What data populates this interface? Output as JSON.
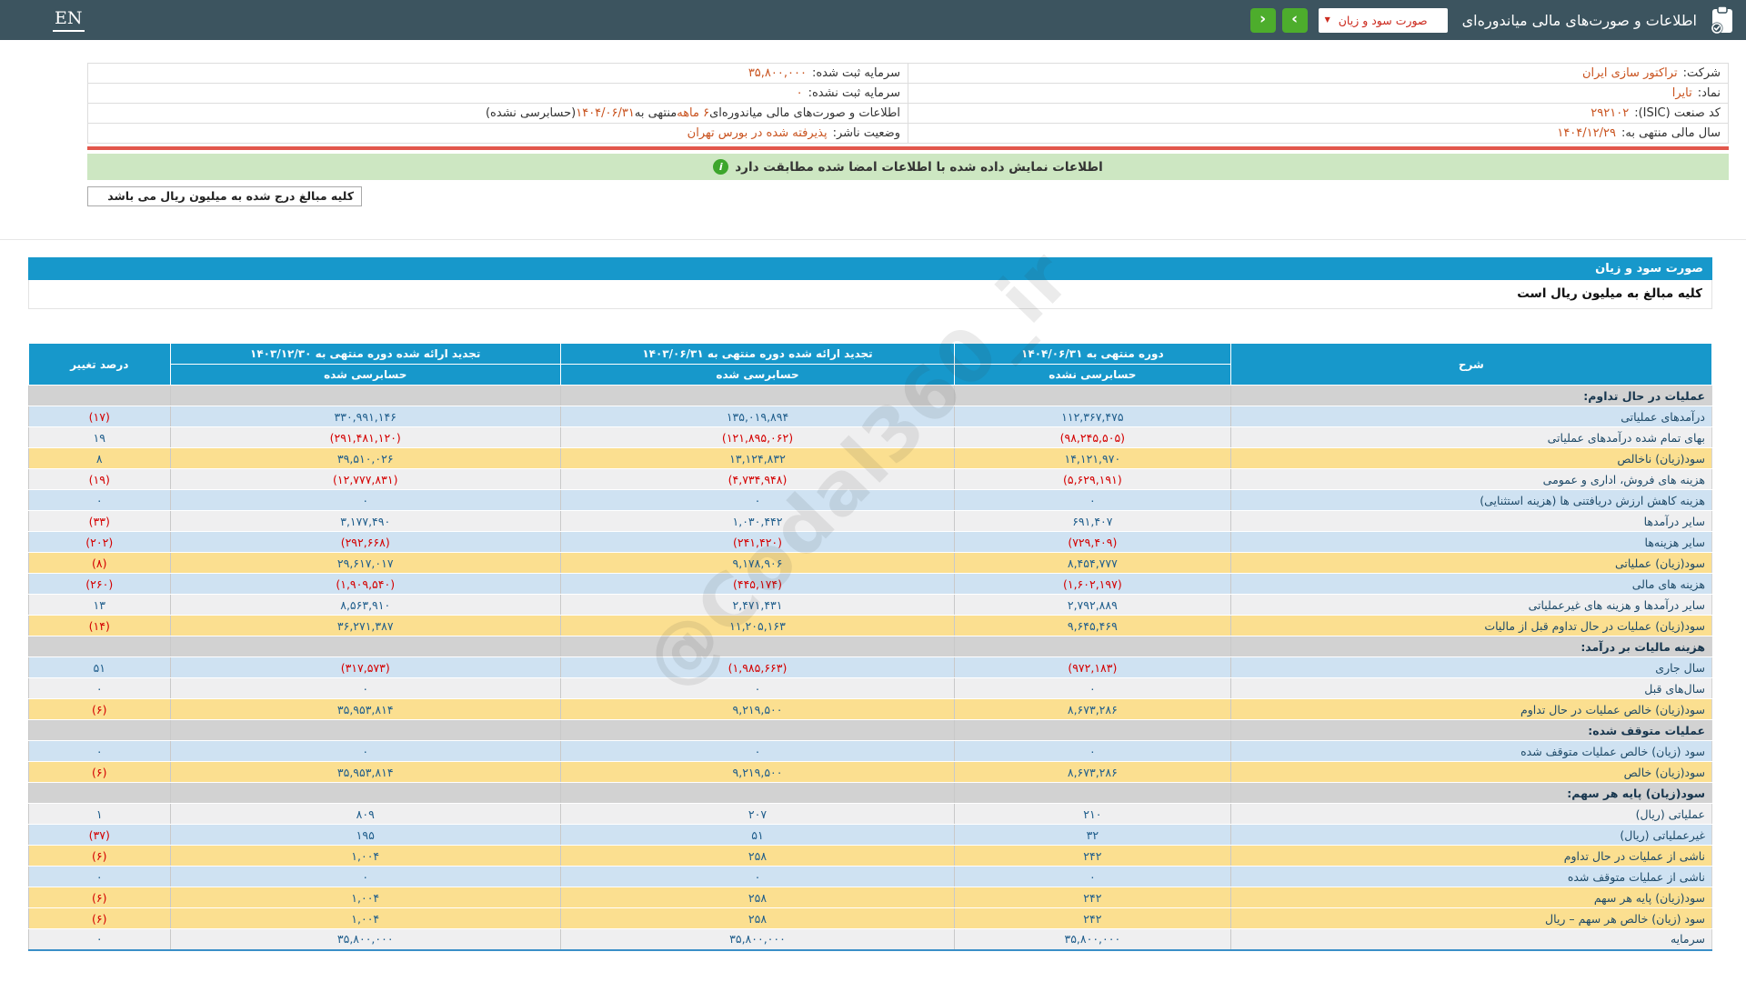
{
  "topbar": {
    "en_label": "EN",
    "title": "اطلاعات و صورت‌های مالی میاندوره‌ای",
    "dropdown_value": "صورت سود و زیان",
    "dropdown_chevron": "▼",
    "next_icon": "›",
    "prev_icon": "‹"
  },
  "info": {
    "rows": [
      {
        "r_label": "شرکت:",
        "r_value": "تراکتور سازی ایران",
        "l_label": "سرمایه ثبت شده:",
        "l_value": "۳۵,۸۰۰,۰۰۰"
      },
      {
        "r_label": "نماد:",
        "r_value": "تایرا",
        "l_label": "سرمایه ثبت نشده:",
        "l_value": "۰"
      },
      {
        "r_label": "کد صنعت (ISIC):",
        "r_value": "۲۹۲۱۰۲",
        "l_segments": [
          {
            "t": "اطلاعات و صورت‌های مالی میاندوره‌ای ",
            "o": false
          },
          {
            "t": "۶ ماهه",
            "o": true
          },
          {
            "t": " منتهی به ",
            "o": false
          },
          {
            "t": "۱۴۰۴/۰۶/۳۱",
            "o": true
          },
          {
            "t": "(حسابرسی نشده)",
            "o": false
          }
        ]
      },
      {
        "r_label": "سال مالی منتهی به:",
        "r_value": "۱۴۰۴/۱۲/۲۹",
        "l_label": "وضعیت ناشر:",
        "l_value": "پذیرفته شده در بورس تهران"
      }
    ]
  },
  "banner": {
    "text": "اطلاعات نمایش داده شده با اطلاعات امضا شده مطابقت دارد",
    "icon": "i"
  },
  "unit_note": "کلیه مبالغ درج شده به میلیون ریال می باشد",
  "section": {
    "title": "صورت سود و زیان",
    "subtitle": "کلیه مبالغ به میلیون ریال است"
  },
  "table": {
    "headers": {
      "desc": "شرح",
      "current": {
        "title": "دوره منتهی به ۱۴۰۴/۰۶/۳۱",
        "sub": "حسابرسی نشده"
      },
      "restated_period": {
        "title": "تجدید ارائه شده دوره منتهی به ۱۴۰۳/۰۶/۳۱",
        "sub": "حسابرسی شده"
      },
      "restated_year": {
        "title": "تجدید ارائه شده دوره منتهی به ۱۴۰۳/۱۲/۳۰",
        "sub": "حسابرسی شده"
      },
      "pct": "درصد تغییر"
    },
    "rows": [
      {
        "type": "section",
        "label": "عملیات در حال تداوم:"
      },
      {
        "type": "data",
        "bg": "blue",
        "label": "درآمدهای عملیاتی",
        "current": "۱۱۲,۳۶۷,۴۷۵",
        "restated_period": "۱۳۵,۰۱۹,۸۹۴",
        "restated_year": "۳۳۰,۹۹۱,۱۴۶",
        "pct": "(۱۷)"
      },
      {
        "type": "data",
        "bg": "gray",
        "label": "بهای تمام شده درآمدهای عملیاتی",
        "current": "(۹۸,۲۴۵,۵۰۵)",
        "restated_period": "(۱۲۱,۸۹۵,۰۶۲)",
        "restated_year": "(۲۹۱,۴۸۱,۱۲۰)",
        "pct": "۱۹"
      },
      {
        "type": "data",
        "bg": "yellow",
        "label": "سود(زیان) ناخالص",
        "current": "۱۴,۱۲۱,۹۷۰",
        "restated_period": "۱۳,۱۲۴,۸۳۲",
        "restated_year": "۳۹,۵۱۰,۰۲۶",
        "pct": "۸"
      },
      {
        "type": "data",
        "bg": "gray",
        "label": "هزینه های فروش، اداری و عمومی",
        "current": "(۵,۶۲۹,۱۹۱)",
        "restated_period": "(۴,۷۳۴,۹۴۸)",
        "restated_year": "(۱۲,۷۷۷,۸۳۱)",
        "pct": "(۱۹)"
      },
      {
        "type": "data",
        "bg": "blue",
        "label": "هزینه کاهش ارزش دریافتنی ها (هزینه استثنایی)",
        "current": "۰",
        "restated_period": "۰",
        "restated_year": "۰",
        "pct": "۰"
      },
      {
        "type": "data",
        "bg": "gray",
        "label": "سایر درآمدها",
        "current": "۶۹۱,۴۰۷",
        "restated_period": "۱,۰۳۰,۴۴۲",
        "restated_year": "۳,۱۷۷,۴۹۰",
        "pct": "(۳۳)"
      },
      {
        "type": "data",
        "bg": "blue",
        "label": "سایر هزینه‌ها",
        "current": "(۷۲۹,۴۰۹)",
        "restated_period": "(۲۴۱,۴۲۰)",
        "restated_year": "(۲۹۲,۶۶۸)",
        "pct": "(۲۰۲)"
      },
      {
        "type": "data",
        "bg": "yellow",
        "label": "سود(زیان) عملیاتی",
        "current": "۸,۴۵۴,۷۷۷",
        "restated_period": "۹,۱۷۸,۹۰۶",
        "restated_year": "۲۹,۶۱۷,۰۱۷",
        "pct": "(۸)"
      },
      {
        "type": "data",
        "bg": "blue",
        "label": "هزینه های مالی",
        "current": "(۱,۶۰۲,۱۹۷)",
        "restated_period": "(۴۴۵,۱۷۴)",
        "restated_year": "(۱,۹۰۹,۵۴۰)",
        "pct": "(۲۶۰)"
      },
      {
        "type": "data",
        "bg": "gray",
        "label": "سایر درآمدها و هزینه های غیرعملیاتی",
        "current": "۲,۷۹۲,۸۸۹",
        "restated_period": "۲,۴۷۱,۴۳۱",
        "restated_year": "۸,۵۶۳,۹۱۰",
        "pct": "۱۳"
      },
      {
        "type": "data",
        "bg": "yellow",
        "label": "سود(زیان) عملیات در حال تداوم قبل از مالیات",
        "current": "۹,۶۴۵,۴۶۹",
        "restated_period": "۱۱,۲۰۵,۱۶۳",
        "restated_year": "۳۶,۲۷۱,۳۸۷",
        "pct": "(۱۴)"
      },
      {
        "type": "section",
        "label": "هزینه مالیات بر درآمد:"
      },
      {
        "type": "data",
        "bg": "blue",
        "label": "سال جاری",
        "current": "(۹۷۲,۱۸۳)",
        "restated_period": "(۱,۹۸۵,۶۶۳)",
        "restated_year": "(۳۱۷,۵۷۳)",
        "pct": "۵۱"
      },
      {
        "type": "data",
        "bg": "gray",
        "label": "سال‌های قبل",
        "current": "۰",
        "restated_period": "۰",
        "restated_year": "۰",
        "pct": "۰"
      },
      {
        "type": "data",
        "bg": "yellow",
        "label": "سود(زیان) خالص عملیات در حال تداوم",
        "current": "۸,۶۷۳,۲۸۶",
        "restated_period": "۹,۲۱۹,۵۰۰",
        "restated_year": "۳۵,۹۵۳,۸۱۴",
        "pct": "(۶)"
      },
      {
        "type": "section",
        "label": "عملیات متوقف شده:"
      },
      {
        "type": "data",
        "bg": "blue",
        "label": "سود (زیان) خالص عملیات متوقف شده",
        "current": "۰",
        "restated_period": "۰",
        "restated_year": "۰",
        "pct": "۰"
      },
      {
        "type": "data",
        "bg": "yellow",
        "label": "سود(زیان) خالص",
        "current": "۸,۶۷۳,۲۸۶",
        "restated_period": "۹,۲۱۹,۵۰۰",
        "restated_year": "۳۵,۹۵۳,۸۱۴",
        "pct": "(۶)"
      },
      {
        "type": "section",
        "label": "سود(زیان) پایه هر سهم:"
      },
      {
        "type": "data",
        "bg": "gray",
        "label": "عملیاتی (ریال)",
        "current": "۲۱۰",
        "restated_period": "۲۰۷",
        "restated_year": "۸۰۹",
        "pct": "۱"
      },
      {
        "type": "data",
        "bg": "blue",
        "label": "غیرعملیاتی (ریال)",
        "current": "۳۲",
        "restated_period": "۵۱",
        "restated_year": "۱۹۵",
        "pct": "(۳۷)"
      },
      {
        "type": "data",
        "bg": "yellow",
        "label": "ناشی از عملیات در حال تداوم",
        "current": "۲۴۲",
        "restated_period": "۲۵۸",
        "restated_year": "۱,۰۰۴",
        "pct": "(۶)"
      },
      {
        "type": "data",
        "bg": "blue",
        "label": "ناشی از عملیات متوقف شده",
        "current": "۰",
        "restated_period": "۰",
        "restated_year": "۰",
        "pct": "۰"
      },
      {
        "type": "data",
        "bg": "yellow",
        "label": "سود(زیان) پایه هر سهم",
        "current": "۲۴۲",
        "restated_period": "۲۵۸",
        "restated_year": "۱,۰۰۴",
        "pct": "(۶)"
      },
      {
        "type": "data",
        "bg": "yellow",
        "label": "سود (زیان) خالص هر سهم – ریال",
        "current": "۲۴۲",
        "restated_period": "۲۵۸",
        "restated_year": "۱,۰۰۴",
        "pct": "(۶)"
      },
      {
        "type": "data",
        "bg": "gray",
        "label": "سرمایه",
        "current": "۳۵,۸۰۰,۰۰۰",
        "restated_period": "۳۵,۸۰۰,۰۰۰",
        "restated_year": "۳۵,۸۰۰,۰۰۰",
        "pct": "۰"
      }
    ]
  },
  "watermark": "@Codal360_ir",
  "colors": {
    "topbar_bg": "#3c545f",
    "accent_blue": "#1798cb",
    "button_green": "#4dad2c",
    "banner_green": "#cde7c2",
    "red_line": "#e2574c",
    "value_navy": "#205e8c",
    "negative_red": "#d40000",
    "info_value_orange": "#c9531f",
    "row_yellow": "#fbdf90",
    "row_blue": "#cfe2f2",
    "row_gray": "#efeff0",
    "section_gray": "#d2d2d2"
  }
}
